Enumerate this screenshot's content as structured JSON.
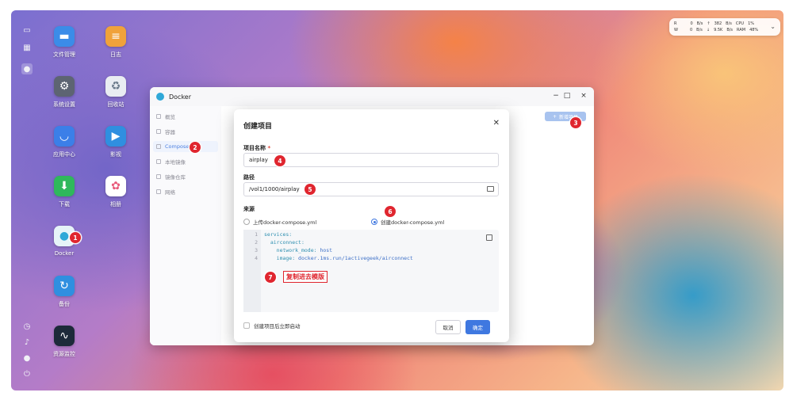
{
  "desktop": {
    "icons": [
      {
        "label": "文件管理",
        "icon": "folder-icon",
        "color": "#3b8ce8"
      },
      {
        "label": "日志",
        "icon": "log-icon",
        "color": "#f0a23a"
      },
      {
        "label": "系统设置",
        "icon": "gear-icon",
        "color": "#5d6472"
      },
      {
        "label": "回收站",
        "icon": "recycle-icon",
        "color": "#8aa0b4"
      },
      {
        "label": "应用中心",
        "icon": "store-icon",
        "color": "#3b7fe8"
      },
      {
        "label": "影视",
        "icon": "film-icon",
        "color": "#2f8fe0"
      },
      {
        "label": "下载",
        "icon": "download-icon",
        "color": "#2fb85c"
      },
      {
        "label": "相册",
        "icon": "photos-icon",
        "color": "#e85a7a"
      },
      {
        "label": "Docker",
        "icon": "docker-icon",
        "color": "#2fa8d8"
      },
      {
        "label": "备份",
        "icon": "backup-icon",
        "color": "#2f8fe0"
      },
      {
        "label": "资源监控",
        "icon": "monitor-icon",
        "color": "#1d2a3a"
      }
    ]
  },
  "stats": {
    "r_label": "R",
    "w_label": "W",
    "r_val": "0",
    "r_unit": "B/s",
    "w_val": "0",
    "w_unit": "B/s",
    "up_val": "382",
    "up_unit": "B/s",
    "down_val": "9.5K",
    "down_unit": "B/s",
    "cpu_label": "CPU",
    "cpu_val": "1%",
    "ram_label": "RAM",
    "ram_val": "48%"
  },
  "window": {
    "title": "Docker",
    "nav": [
      "概览",
      "容器",
      "Compose",
      "本地镜像",
      "镜像仓库",
      "网络"
    ],
    "new_project": "新增项目"
  },
  "modal": {
    "title": "创建项目",
    "name_label": "项目名称",
    "name_required": "*",
    "name_value": "airplay",
    "path_label": "路径",
    "path_value": "/vol1/1000/airplay",
    "source_label": "来源",
    "source_upload": "上传docker-compose.yml",
    "source_create": "创建docker-compose.yml",
    "code_lines": [
      {
        "n": "1",
        "key": "services:",
        "val": ""
      },
      {
        "n": "2",
        "key": "  airconnect:",
        "val": ""
      },
      {
        "n": "3",
        "key": "    network_mode:",
        "val": " host"
      },
      {
        "n": "4",
        "key": "    image:",
        "val": " docker.1ms.run/1activegeek/airconnect"
      }
    ],
    "note": "复制进去模版",
    "auto_start": "创建项目后立即启动",
    "cancel": "取消",
    "confirm": "确定"
  },
  "badges": [
    "1",
    "2",
    "3",
    "4",
    "5",
    "6",
    "7"
  ]
}
